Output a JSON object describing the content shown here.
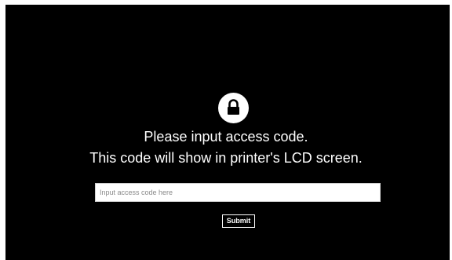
{
  "lock": {
    "icon": "lock-icon"
  },
  "message": {
    "line1": "Please input access code.",
    "line2": "This code will show in printer's LCD screen."
  },
  "access_code": {
    "value": "",
    "placeholder": "Input access code here"
  },
  "submit": {
    "label": "Submit"
  },
  "colors": {
    "background": "#000000",
    "text": "#ffffff",
    "input_background": "#ffffff"
  }
}
